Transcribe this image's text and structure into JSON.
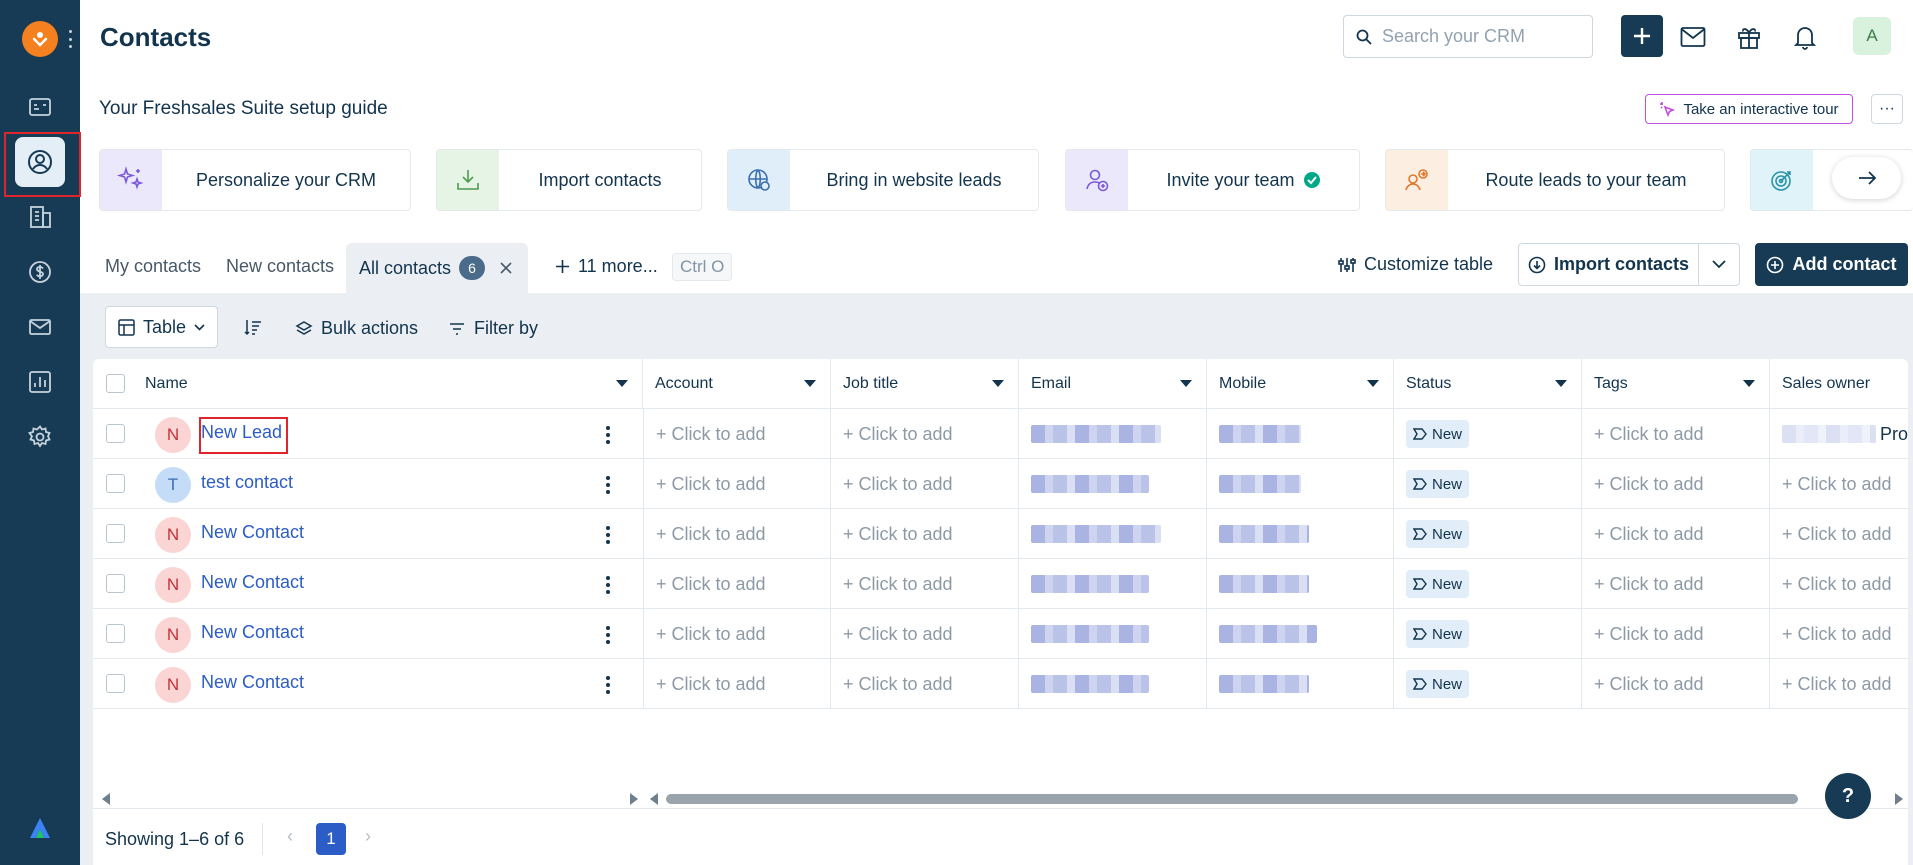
{
  "header": {
    "title": "Contacts",
    "search_placeholder": "Search your CRM",
    "avatar_initial": "A"
  },
  "guide": {
    "title": "Your Freshsales Suite setup guide",
    "tour_label": "Take an interactive tour",
    "more_label": "···",
    "cards": [
      {
        "label": "Personalize your CRM",
        "icon": "sparkle-icon",
        "bg": "#ece8fb"
      },
      {
        "label": "Import contacts",
        "icon": "download-tray-icon",
        "bg": "#e6f4e6"
      },
      {
        "label": "Bring in website leads",
        "icon": "globe-icon",
        "bg": "#e0eefa"
      },
      {
        "label": "Invite your team",
        "icon": "add-user-icon",
        "bg": "#ece8fb"
      },
      {
        "label": "Route leads to your team",
        "icon": "route-user-icon",
        "bg": "#fdeee2"
      },
      {
        "label": "",
        "icon": "target-icon",
        "bg": "#dff3f8"
      }
    ]
  },
  "tabs": {
    "my_contacts": "My contacts",
    "new_contacts": "New contacts",
    "all_contacts": "All contacts",
    "all_count": "6",
    "more": "11 more...",
    "shortcut": "Ctrl O"
  },
  "actions": {
    "customize": "Customize table",
    "import": "Import contacts",
    "add": "Add contact"
  },
  "toolbar": {
    "view": "Table",
    "bulk": "Bulk actions",
    "filter": "Filter by"
  },
  "table": {
    "columns": [
      "Name",
      "Account",
      "Job title",
      "Email",
      "Mobile",
      "Status",
      "Tags",
      "Sales owner"
    ],
    "placeholder": "+ Click to add",
    "owner_partial": "Pro",
    "rows": [
      {
        "initial": "N",
        "name": "New Lead",
        "status": "New"
      },
      {
        "initial": "T",
        "name": "test contact",
        "status": "New"
      },
      {
        "initial": "N",
        "name": "New Contact",
        "status": "New"
      },
      {
        "initial": "N",
        "name": "New Contact",
        "status": "New"
      },
      {
        "initial": "N",
        "name": "New Contact",
        "status": "New"
      },
      {
        "initial": "N",
        "name": "New Contact",
        "status": "New"
      }
    ]
  },
  "footer": {
    "showing": "Showing 1–6 of 6",
    "page": "1"
  },
  "help_label": "?",
  "colors": {
    "sidebar": "#173b54",
    "accent": "#2c5cc5",
    "highlight": "#e0242c"
  }
}
